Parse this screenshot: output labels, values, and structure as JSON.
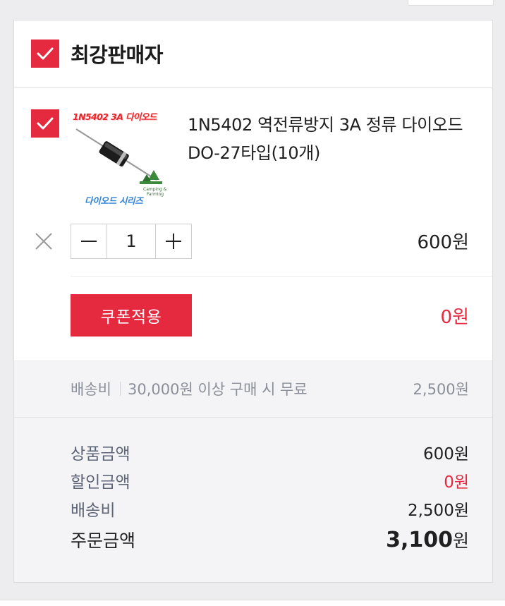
{
  "seller": {
    "name": "최강판매자",
    "checked": true
  },
  "item": {
    "checked": true,
    "name": "1N5402 역전류방지 3A 정류 다이오드 DO-27타입(10개)",
    "thumbnail": {
      "title_text": "1N5402 3A 다이오드",
      "sub_text": "다이오드 시리즈",
      "badge_line1": "Camping &",
      "badge_line2": "Farming"
    },
    "quantity": "1",
    "price": "600원",
    "remove_icon": "close-icon",
    "decrement_icon": "minus-icon",
    "increment_icon": "plus-icon"
  },
  "coupon": {
    "button_label": "쿠폰적용",
    "discount": "0원"
  },
  "shipping": {
    "label": "배송비",
    "condition": "30,000원 이상 구매 시 무료",
    "fee": "2,500원"
  },
  "summary": {
    "product_amount_label": "상품금액",
    "product_amount": "600원",
    "discount_label": "할인금액",
    "discount": "0원",
    "shipping_label": "배송비",
    "shipping": "2,500원",
    "total_label": "주문금액",
    "total_number": "3,100",
    "total_unit": "원"
  },
  "colors": {
    "accent": "#e5293f",
    "muted_text": "#8a8f99",
    "band_background": "#f4f4f6"
  }
}
